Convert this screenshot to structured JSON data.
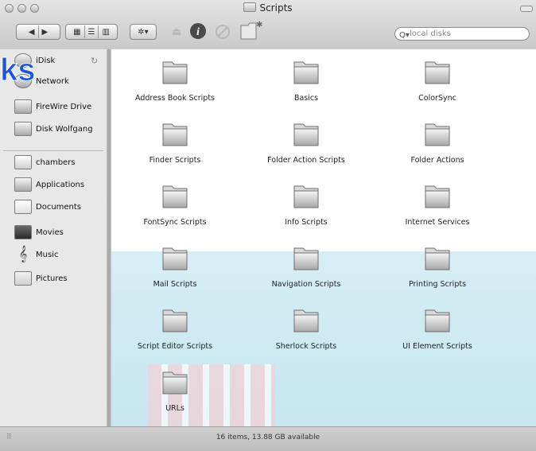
{
  "window": {
    "title": "Scripts"
  },
  "toolbar": {
    "search_placeholder": "local disks",
    "nav_buttons": [
      "back",
      "forward"
    ],
    "view_buttons": [
      "icon-view",
      "list-view",
      "column-view"
    ]
  },
  "sidebar": {
    "items": [
      {
        "label": "iDisk",
        "icon": "idisk-icon"
      },
      {
        "label": "Network",
        "icon": "network-icon"
      },
      {
        "label": "FireWire Drive",
        "icon": "firewire-drive-icon"
      },
      {
        "label": "Disk Wolfgang",
        "icon": "disk-icon"
      },
      {
        "label": "chambers",
        "icon": "home-icon"
      },
      {
        "label": "Applications",
        "icon": "applications-icon"
      },
      {
        "label": "Documents",
        "icon": "documents-icon"
      },
      {
        "label": "Movies",
        "icon": "movies-icon"
      },
      {
        "label": "Music",
        "icon": "music-icon"
      },
      {
        "label": "Pictures",
        "icon": "pictures-icon"
      }
    ]
  },
  "folders": [
    {
      "name": "Address Book Scripts"
    },
    {
      "name": "Basics"
    },
    {
      "name": "ColorSync"
    },
    {
      "name": "Finder Scripts"
    },
    {
      "name": "Folder Action Scripts"
    },
    {
      "name": "Folder Actions"
    },
    {
      "name": "FontSync Scripts"
    },
    {
      "name": "Info Scripts"
    },
    {
      "name": "Internet Services"
    },
    {
      "name": "Mail Scripts"
    },
    {
      "name": "Navigation Scripts"
    },
    {
      "name": "Printing Scripts"
    },
    {
      "name": "Script Editor Scripts"
    },
    {
      "name": "Sherlock Scripts"
    },
    {
      "name": "UI Element Scripts"
    },
    {
      "name": "URLs"
    }
  ],
  "status": {
    "text": "16 items, 13.88 GB available"
  },
  "overlay": {
    "text": "ks"
  },
  "colors": {
    "metal_light": "#e4e4e4",
    "metal_dark": "#c9c9c9",
    "sidebar_bg": "#e8e8e8",
    "overlay_blue": "#1a55e0"
  }
}
